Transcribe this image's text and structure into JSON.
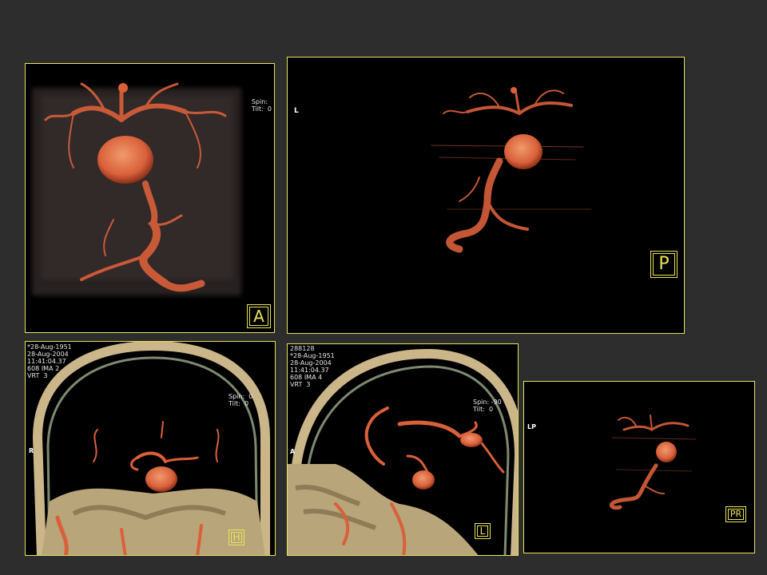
{
  "colors": {
    "background": "#2d2d2d",
    "panel_border": "#e8e35a",
    "vessel": "#d9603a",
    "bone": "#cbb68a"
  },
  "panels": {
    "a": {
      "spin_tilt": "Spin:\nTilt:  0",
      "badge": "A"
    },
    "p": {
      "orientation": "L",
      "badge": "P"
    },
    "coronal": {
      "info": "*28-Aug-1951\n28-Aug-2004\n11:41:04.37\n608 IMA 2\nVRT  3",
      "spin_tilt": "Spin:  0\nTilt:  0",
      "orientation": "R",
      "badge": "H"
    },
    "sagittal": {
      "info": "288128\n*28-Aug-1951\n28-Aug-2004\n11:41:04.37\n608 IMA 4\nVRT  3",
      "spin_tilt": "Spin: -90\nTilt:  0",
      "orientation": "A",
      "badge": "L"
    },
    "small": {
      "orientation": "LP",
      "badge": "PR"
    }
  }
}
